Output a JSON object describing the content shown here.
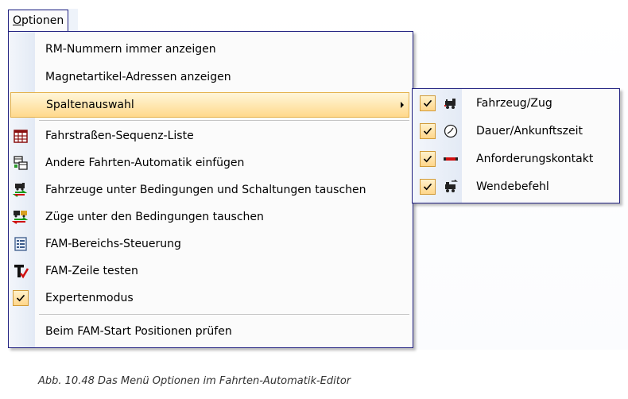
{
  "menu": {
    "title_underlined": "O",
    "title_rest": "ptionen",
    "items": [
      {
        "label": "RM-Nummern immer anzeigen"
      },
      {
        "label": "Magnetartikel-Adressen anzeigen"
      },
      {
        "label": "Spaltenauswahl"
      },
      {
        "label": "Fahrstraßen-Sequenz-Liste"
      },
      {
        "label": "Andere Fahrten-Automatik einfügen"
      },
      {
        "label": "Fahrzeuge unter Bedingungen und Schaltungen tauschen"
      },
      {
        "label": "Züge unter den Bedingungen tauschen"
      },
      {
        "label": "FAM-Bereichs-Steuerung"
      },
      {
        "label": "FAM-Zeile testen"
      },
      {
        "label": "Expertenmodus"
      },
      {
        "label": "Beim FAM-Start Positionen prüfen"
      }
    ]
  },
  "submenu": {
    "items": [
      {
        "label": "Fahrzeug/Zug"
      },
      {
        "label": "Dauer/Ankunftszeit"
      },
      {
        "label": "Anforderungskontakt"
      },
      {
        "label": "Wendebefehl"
      }
    ]
  },
  "caption": "Abb. 10.48  Das Menü Optionen im Fahrten-Automatik-Editor",
  "colors": {
    "menu_border": "#202080",
    "highlight": "#ffd98c",
    "check_border": "#d19b39"
  }
}
